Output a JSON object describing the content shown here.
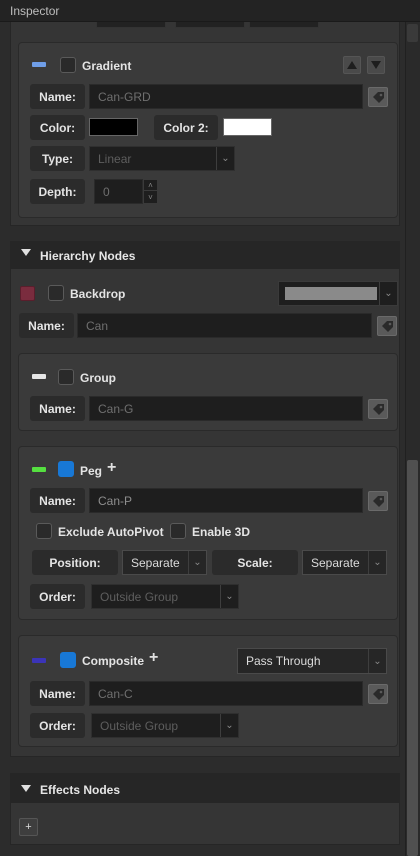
{
  "window": {
    "title": "Inspector"
  },
  "gradient_panel": {
    "title": "Gradient",
    "accent_color": "#6f9ee8",
    "enabled": false,
    "name_label": "Name:",
    "name_value": "Can-GRD",
    "color_label": "Color:",
    "color_value": "#000000",
    "color2_label": "Color 2:",
    "color2_value": "#ffffff",
    "type_label": "Type:",
    "type_value": "Linear",
    "depth_label": "Depth:",
    "depth_value": "0"
  },
  "hierarchy_section": {
    "title": "Hierarchy Nodes",
    "backdrop": {
      "title": "Backdrop",
      "accent_color": "#7a2c3e",
      "enabled": false,
      "color_value": "#8a8a8a",
      "name_label": "Name:",
      "name_value": "Can"
    },
    "group": {
      "title": "Group",
      "accent_color": "#e6e6e6",
      "enabled": false,
      "name_label": "Name:",
      "name_value": "Can-G"
    },
    "peg": {
      "title": "Peg",
      "accent_color": "#55e040",
      "enabled": true,
      "add_symbol": "+",
      "name_label": "Name:",
      "name_value": "Can-P",
      "exclude_autopivot_label": "Exclude AutoPivot",
      "enable3d_label": "Enable 3D",
      "position_label": "Position:",
      "position_value": "Separate",
      "scale_label": "Scale:",
      "scale_value": "Separate",
      "order_label": "Order:",
      "order_value": "Outside Group"
    },
    "composite": {
      "title": "Composite",
      "accent_color": "#3b34b8",
      "enabled": true,
      "add_symbol": "+",
      "mode_value": "Pass Through",
      "name_label": "Name:",
      "name_value": "Can-C",
      "order_label": "Order:",
      "order_value": "Outside Group"
    }
  },
  "effects_section": {
    "title": "Effects Nodes",
    "add_symbol": "+"
  },
  "icons": {
    "collapse": "triangle-down-icon",
    "dropdown": "chevron-down-icon",
    "tag": "tag-icon",
    "move_up": "arrow-up-icon",
    "move_down": "arrow-down-icon"
  }
}
